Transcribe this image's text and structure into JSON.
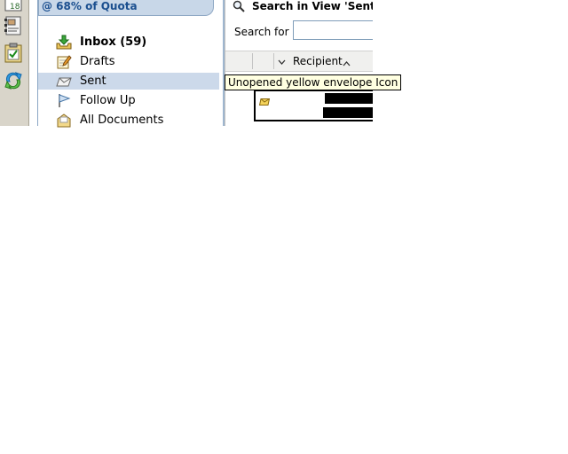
{
  "navigator": {
    "quota_text": "@ 68% of Quota",
    "items": [
      {
        "label": "Inbox (59)",
        "icon": "inbox-tray-icon",
        "bold": true,
        "selected": false
      },
      {
        "label": "Drafts",
        "icon": "drafts-pencil-icon",
        "bold": false,
        "selected": false
      },
      {
        "label": "Sent",
        "icon": "sent-envelope-icon",
        "bold": false,
        "selected": true
      },
      {
        "label": "Follow Up",
        "icon": "follow-up-flag-icon",
        "bold": false,
        "selected": false
      },
      {
        "label": "All Documents",
        "icon": "all-documents-icon",
        "bold": false,
        "selected": false
      }
    ]
  },
  "view": {
    "search_title": "Search in View 'Sent'",
    "search_label": "Search for",
    "search_value": "",
    "columns": [
      {
        "label": "Recipient",
        "sort": "ascending"
      }
    ],
    "partial_cell": "9"
  },
  "tooltip": {
    "text": "Unopened yellow envelope Icon"
  },
  "colors": {
    "quota_bg": "#c8d7e8",
    "quota_text": "#1b4f8f",
    "selected_row": "#ccd9ea",
    "tooltip_bg": "#ffffe1"
  }
}
